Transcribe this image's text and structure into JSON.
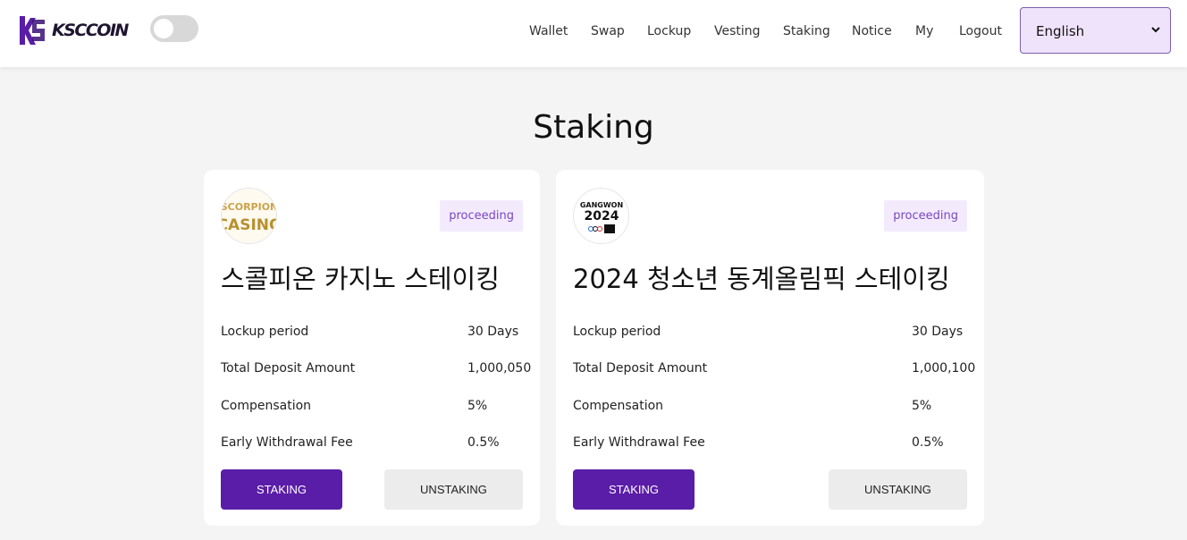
{
  "brand": {
    "name": "KSCCOIN",
    "mark": "KSC"
  },
  "nav": {
    "items": [
      "Wallet",
      "Swap",
      "Lockup",
      "Vesting",
      "Staking",
      "Notice",
      "My",
      "Logout"
    ],
    "language": "English"
  },
  "theme_toggle": {
    "on": false
  },
  "colors": {
    "accent": "#5a1da8",
    "badge_bg": "#f3ebfd",
    "badge_text": "#7a45c4",
    "page_bg": "#f4f4f4"
  },
  "page": {
    "title": "Staking"
  },
  "cards": [
    {
      "logo_text": [
        "SCORPION",
        "CASINO"
      ],
      "status": "proceeding",
      "title": "스콜피온 카지노 스테이킹",
      "rows": [
        {
          "label": "Lockup period",
          "value": "30 Days"
        },
        {
          "label": "Total Deposit Amount",
          "value": "1,000,050"
        },
        {
          "label": "Compensation",
          "value": "5%"
        },
        {
          "label": "Early Withdrawal Fee",
          "value": "0.5%"
        }
      ],
      "stake_label": "STAKING",
      "unstake_label": "UNSTAKING"
    },
    {
      "logo_text": [
        "GANGWON",
        "2024"
      ],
      "status": "proceeding",
      "title": "2024 청소년 동계올림픽 스테이킹",
      "rows": [
        {
          "label": "Lockup period",
          "value": "30 Days"
        },
        {
          "label": "Total Deposit Amount",
          "value": "1,000,100"
        },
        {
          "label": "Compensation",
          "value": "5%"
        },
        {
          "label": "Early Withdrawal Fee",
          "value": "0.5%"
        }
      ],
      "stake_label": "STAKING",
      "unstake_label": "UNSTAKING"
    }
  ]
}
